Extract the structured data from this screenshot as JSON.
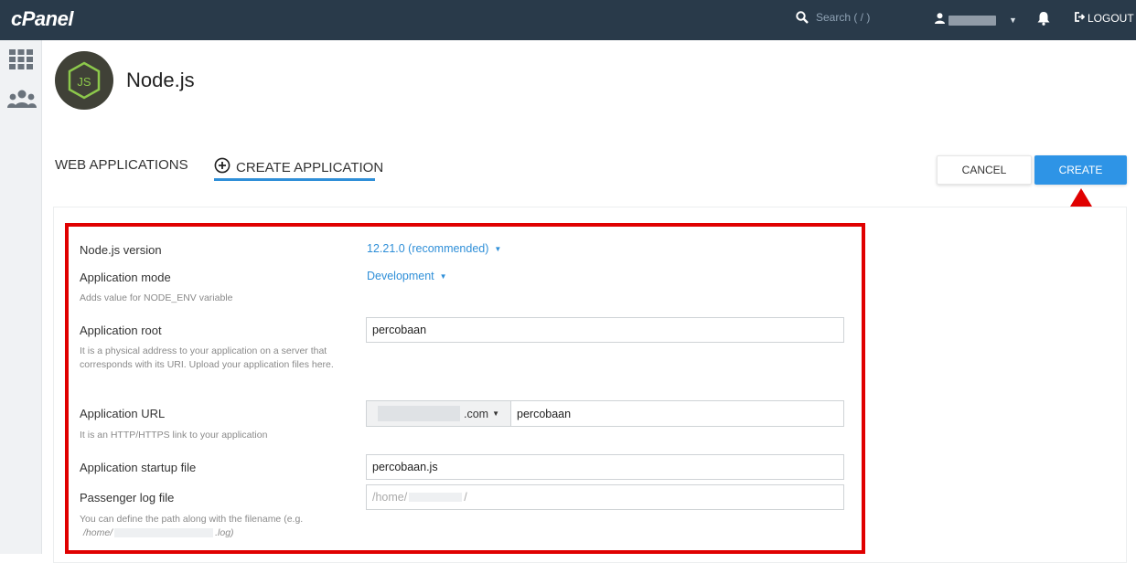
{
  "topbar": {
    "logo": "cPanel",
    "search_placeholder": "Search ( / )",
    "logout_label": "LOGOUT"
  },
  "header": {
    "title": "Node.js"
  },
  "tabs": {
    "web_apps": "WEB APPLICATIONS",
    "create_app": "CREATE APPLICATION"
  },
  "actions": {
    "cancel": "CANCEL",
    "create": "CREATE"
  },
  "form": {
    "nodejs_version": {
      "label": "Node.js version",
      "value": "12.21.0 (recommended)"
    },
    "app_mode": {
      "label": "Application mode",
      "value": "Development",
      "hint": "Adds value for NODE_ENV variable"
    },
    "app_root": {
      "label": "Application root",
      "value": "percobaan",
      "hint": "It is a physical address to your application on a server that corresponds with its URI. Upload your application files here."
    },
    "app_url": {
      "label": "Application URL",
      "domain_suffix": ".com",
      "path": "percobaan",
      "hint": "It is an HTTP/HTTPS link to your application"
    },
    "startup_file": {
      "label": "Application startup file",
      "value": "percobaan.js"
    },
    "passenger_log": {
      "label": "Passenger log file",
      "placeholder_prefix": "/home/",
      "placeholder_suffix": "/",
      "hint_prefix": "You can define the path along with the filename (e.g.",
      "hint_path_prefix": "/home/",
      "hint_path_suffix": ".log)"
    }
  },
  "colors": {
    "topbar_bg": "#293a4a",
    "accent": "#2e94e6",
    "annotation_red": "#e00000",
    "node_logo_bg": "#404137",
    "node_logo_fg": "#8cc84b"
  }
}
